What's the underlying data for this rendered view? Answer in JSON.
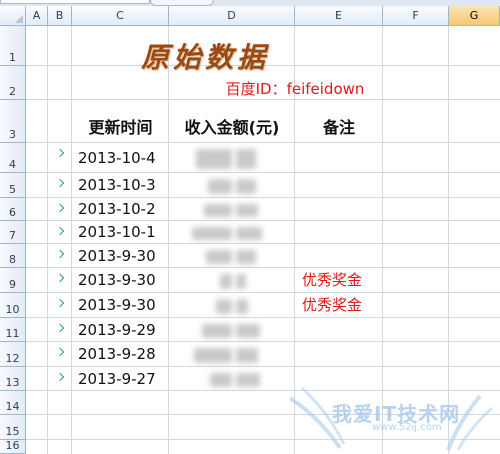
{
  "columns": [
    "A",
    "B",
    "C",
    "D",
    "E",
    "F",
    "G"
  ],
  "selected_column": "G",
  "rows": [
    "1",
    "2",
    "3",
    "4",
    "5",
    "6",
    "7",
    "8",
    "9",
    "10",
    "11",
    "12",
    "13",
    "14",
    "15",
    "16"
  ],
  "sheet": {
    "title": "原始数据",
    "subtitle": "百度ID：feifeidown",
    "headers": {
      "date": "更新时间",
      "income": "收入金额(元)",
      "note": "备注"
    },
    "records": [
      {
        "date": "2013-10-4",
        "note": ""
      },
      {
        "date": "2013-10-3",
        "note": ""
      },
      {
        "date": "2013-10-2",
        "note": ""
      },
      {
        "date": "2013-10-1",
        "note": ""
      },
      {
        "date": "2013-9-30",
        "note": ""
      },
      {
        "date": "2013-9-30",
        "note": "优秀奖金"
      },
      {
        "date": "2013-9-30",
        "note": "优秀奖金"
      },
      {
        "date": "2013-9-29",
        "note": ""
      },
      {
        "date": "2013-9-28",
        "note": ""
      },
      {
        "date": "2013-9-27",
        "note": ""
      }
    ]
  },
  "watermark": {
    "text": "我爱IT技术网",
    "url": "www.52ij.com"
  },
  "colors": {
    "title": "#9a4a12",
    "subtitle": "#e01818",
    "note": "#e01818",
    "error_indicator": "#2aa94a",
    "grid": "#d0d7e5"
  }
}
